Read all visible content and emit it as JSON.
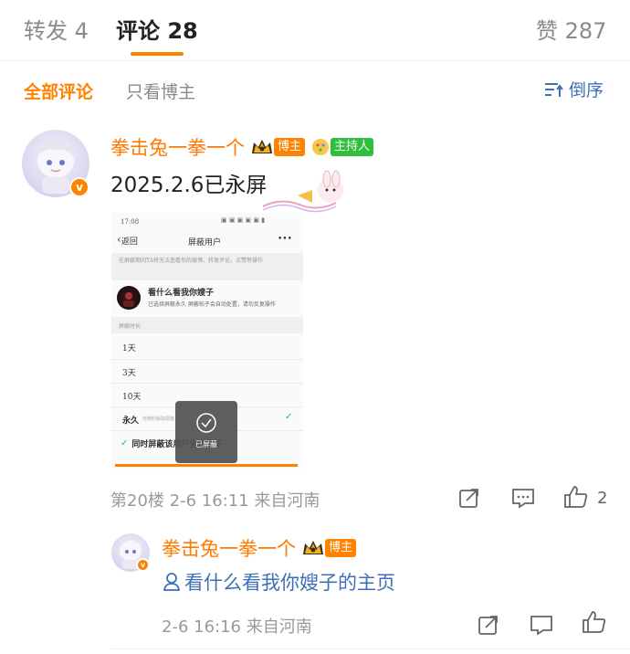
{
  "header": {
    "tabs": [
      {
        "label": "转发 4"
      },
      {
        "label": "评论 28"
      },
      {
        "label": "赞 287"
      }
    ]
  },
  "filters": {
    "all": "全部评论",
    "owner_only": "只看博主",
    "sort": "倒序"
  },
  "comment": {
    "username": "拳击兔一拳一个",
    "tag_owner": "博主",
    "tag_host": "主持人",
    "text": "2025.2.6已永屏",
    "floor_meta": "第20楼 2-6 16:11 来自河南",
    "like_count": "2",
    "screenshot": {
      "status_time": "17:08",
      "nav_back": "返回",
      "nav_title": "屏蔽用户",
      "nav_more": "•••",
      "notice": "在屏蔽期间TA将无法查看你的微博、转发评论、点赞等操作",
      "user_name": "看什么看我你嫂子",
      "user_desc": "已选择屏蔽永久 屏蔽帖子会自动处置，请勿反复操作",
      "section_label": "屏蔽时长",
      "options": [
        "1天",
        "3天",
        "10天"
      ],
      "permanent": "永久",
      "permanent_note": "可随时解除屏蔽",
      "also_block": "同时屏蔽该用户全部帖子",
      "toast_text": "已屏蔽"
    }
  },
  "reply": {
    "username": "拳击兔一拳一个",
    "tag_owner": "博主",
    "text": "看什么看我你嫂子的主页",
    "meta": "2-6 16:16 来自河南"
  },
  "colors": {
    "accent": "#ff8200",
    "host_tag": "#2fbf3b",
    "link": "#3f6fb5"
  },
  "icons": {
    "sort": "sort-desc-icon",
    "share": "share-icon",
    "comment": "comment-icon",
    "like": "thumbs-up-icon",
    "crown": "crown-icon",
    "vip": "vip-badge-icon",
    "user": "user-link-icon"
  }
}
